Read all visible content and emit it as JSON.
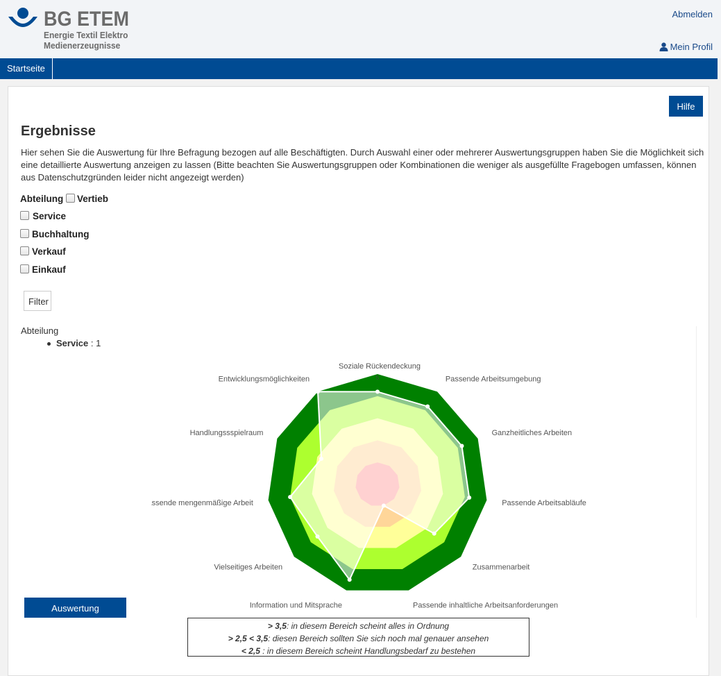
{
  "header": {
    "logo_title": "BG ETEM",
    "logo_sub_1": "Energie Textil Elektro",
    "logo_sub_2": "Medienerzeugnisse",
    "logout": "Abmelden",
    "profile": "Mein Profil",
    "logo_color": "#004b93"
  },
  "nav": {
    "home": "Startseite"
  },
  "help_label": "Hilfe",
  "title": "Ergebnisse",
  "intro": "Hier sehen Sie die Auswertung für Ihre Befragung bezogen auf alle Beschäftigten. Durch Auswahl einer oder mehrerer Auswertungsgruppen haben Sie die Möglichkeit sich eine detaillierte Auswertung anzeigen zu lassen (Bitte beachten Sie Auswertungsgruppen oder Kombinationen die weniger als ausgefüllte Fragebogen umfassen, können aus Datenschutzgründen leider nicht angezeigt werden)",
  "filter": {
    "group_label": "Abteilung",
    "options": [
      {
        "label": "Vertieb",
        "checked": false
      },
      {
        "label": "Service",
        "checked": false
      },
      {
        "label": "Buchhaltung",
        "checked": false
      },
      {
        "label": "Verkauf",
        "checked": false
      },
      {
        "label": "Einkauf",
        "checked": false
      }
    ],
    "button": "Filter"
  },
  "selection": {
    "label": "Abteilung",
    "item_name": "Service",
    "item_value": " : 1"
  },
  "export_label": "Auswertung exportieren",
  "legend": [
    {
      "range": "> 3,5",
      "text": ": in diesem Bereich scheint alles in Ordnung"
    },
    {
      "range": "> 2,5 < 3,5",
      "text": ": diesen Bereich sollten Sie sich noch mal genauer ansehen"
    },
    {
      "range": "< 2,5",
      "text": " : in diesem Bereich scheint Handlungsbedarf zu bestehen"
    }
  ],
  "chart_data": {
    "type": "radar",
    "axis_max": 5,
    "axis_max_label": "5",
    "categories": [
      "Soziale Rückendeckung",
      "Passende Arbeitsumgebung",
      "Ganzheitliches Arbeiten",
      "Passende Arbeitsabläufe",
      "Zusammenarbeit",
      "Passende inhaltliche Arbeitsanforderungen",
      "Information und Mitsprache",
      "Vielseitiges Arbeiten",
      "Passende mengenmäßige Arbeit",
      "Handlungssspielraum",
      "Entwicklungsmöglichkeiten"
    ],
    "bands": [
      {
        "from": 0,
        "to": 1,
        "color": "#ff9999"
      },
      {
        "from": 1,
        "to": 2,
        "color": "#ffd699"
      },
      {
        "from": 2,
        "to": 3,
        "color": "#ffff99"
      },
      {
        "from": 3,
        "to": 4,
        "color": "#adff2f"
      },
      {
        "from": 4,
        "to": 5,
        "color": "#008000"
      }
    ],
    "series": [
      {
        "values": [
          4.2,
          4.2,
          4.2,
          4.2,
          3.4,
          1.0,
          4.5,
          3.6,
          4.0,
          2.8,
          5.0
        ],
        "fill": "#ffffff",
        "fill_opacity": 0.55,
        "stroke": "#ffffff"
      }
    ]
  }
}
